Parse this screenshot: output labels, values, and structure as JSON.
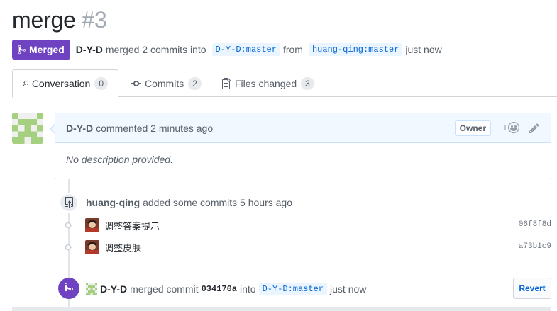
{
  "pr": {
    "title": "merge",
    "number": "#3",
    "state": "Merged",
    "author": "D-Y-D",
    "merged_text": "merged 2 commits into",
    "base_branch": "D-Y-D:master",
    "from_text": "from",
    "head_branch": "huang-qing:master",
    "time": "just now"
  },
  "tabs": [
    {
      "label": "Conversation",
      "count": "0",
      "icon": "comment-discussion-icon"
    },
    {
      "label": "Commits",
      "count": "2",
      "icon": "git-commit-icon"
    },
    {
      "label": "Files changed",
      "count": "3",
      "icon": "file-diff-icon"
    }
  ],
  "comment": {
    "author": "D-Y-D",
    "action": "commented 2 minutes ago",
    "badge": "Owner",
    "reaction": "+",
    "body": "No description provided."
  },
  "push": {
    "author": "huang-qing",
    "text": "added some commits 5 hours ago",
    "commits": [
      {
        "message": "调整答案提示",
        "sha": "06f8f8d"
      },
      {
        "message": "调整皮肤",
        "sha": "a73b1c9"
      }
    ]
  },
  "merge_event": {
    "author": "D-Y-D",
    "text1": "merged commit",
    "sha": "034170a",
    "text2": "into",
    "branch": "D-Y-D:master",
    "time": "just now",
    "revert": "Revert"
  },
  "colors": {
    "merged": "#6f42c1",
    "link": "#0366d6",
    "branch_bg": "#eaf5ff",
    "comment_header": "#f1f8ff"
  }
}
